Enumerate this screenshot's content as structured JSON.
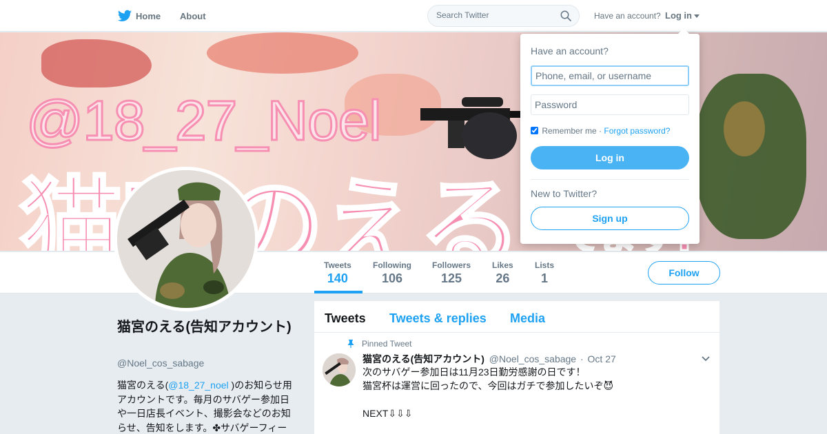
{
  "nav": {
    "logo_icon": "twitter-bird-icon",
    "home_label": "Home",
    "about_label": "About",
    "search_placeholder": "Search Twitter",
    "have_account": "Have an account?",
    "login_label": "Log in"
  },
  "banner": {
    "handle_text": "@18_27_Noel",
    "name_text": "猫宮のえる",
    "sub_text": "てます!"
  },
  "stats": [
    {
      "label": "Tweets",
      "value": "140"
    },
    {
      "label": "Following",
      "value": "106"
    },
    {
      "label": "Followers",
      "value": "125"
    },
    {
      "label": "Likes",
      "value": "26"
    },
    {
      "label": "Lists",
      "value": "1"
    }
  ],
  "follow_label": "Follow",
  "profile": {
    "name": "猫宮のえる(告知アカウント)",
    "handle": "@Noel_cos_sabage",
    "bio_before": "猫宮のえる(",
    "bio_link": "@18_27_noel",
    "bio_after": " )のお知らせ用アカウントです。毎月のサバゲー参加日や一日店長イベント、撮影会などのお知らせ、告知をします。✤サバゲーフィー"
  },
  "timeline": {
    "tabs": [
      "Tweets",
      "Tweets & replies",
      "Media"
    ],
    "pinned_label": "Pinned Tweet",
    "tweet": {
      "name": "猫宮のえる(告知アカウント)",
      "handle": "@Noel_cos_sabage",
      "dot": "·",
      "time": "Oct 27",
      "text": "次のサバゲー参加日は11月23日勤労感謝の日です！\n猫宮杯は運営に回ったので、今回はガチで参加したいぞ😈\n\nNEXT⇩⇩⇩"
    }
  },
  "login_dropdown": {
    "title": "Have an account?",
    "username_placeholder": "Phone, email, or username",
    "password_placeholder": "Password",
    "remember_label": "Remember me",
    "separator": "·",
    "forgot_label": "Forgot password?",
    "login_button": "Log in",
    "new_label": "New to Twitter?",
    "signup_button": "Sign up"
  },
  "colors": {
    "accent": "#1da1f2",
    "login_button": "#4ab3f4",
    "banner_pink": "#f78fb3"
  }
}
